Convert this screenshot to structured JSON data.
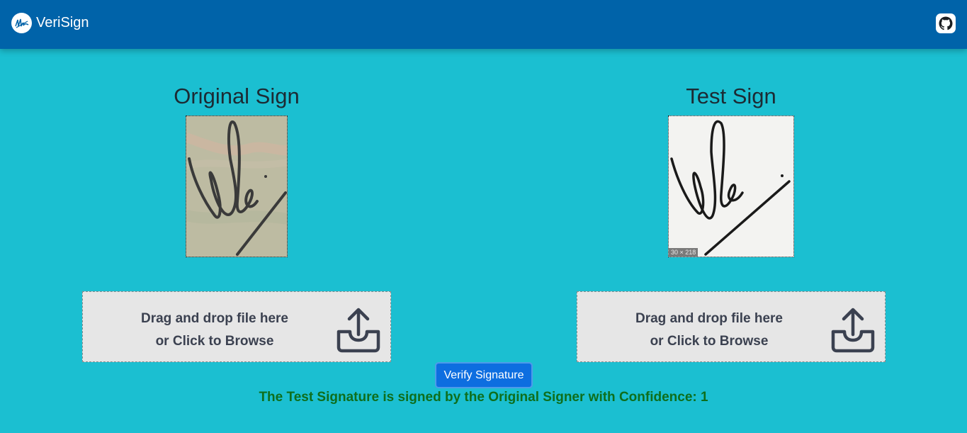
{
  "navbar": {
    "brand": "VeriSign",
    "logo_icon": "signature-logo-icon",
    "github_icon": "github-icon"
  },
  "original": {
    "title": "Original Sign",
    "dropzone_line1": "Drag and drop file here",
    "dropzone_line2": "or Click to Browse",
    "upload_icon": "upload-icon"
  },
  "test": {
    "title": "Test Sign",
    "image_badge": "30 × 218",
    "dropzone_line1": "Drag and drop file here",
    "dropzone_line2": "or Click to Browse",
    "upload_icon": "upload-icon"
  },
  "verify_button": "Verify Signature",
  "result_text": "The Test Signature is signed by the Original Signer with Confidence: 1",
  "colors": {
    "navbar": "#0063a9",
    "background": "#1bbfd1",
    "button": "#0d6ee0",
    "result": "#0e6e1c"
  }
}
